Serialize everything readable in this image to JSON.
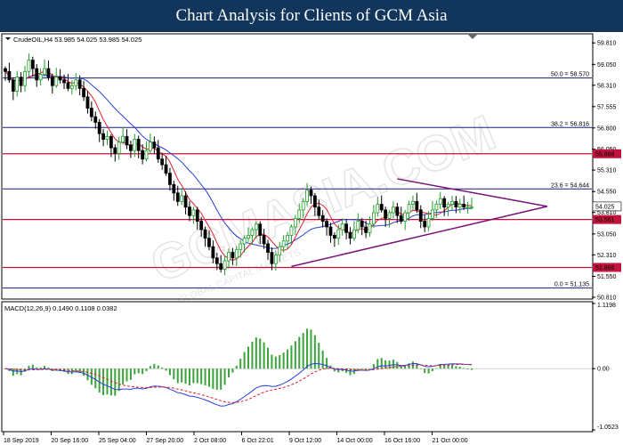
{
  "header": {
    "title": "Chart Analysis for Clients of GCM Asia"
  },
  "watermark": {
    "text": "GCMASIA.COM",
    "subtext": "GLOBAL CAPITAL MARKETS"
  },
  "chart_data": [
    {
      "type": "candlestick",
      "title": "CrudeOIL,H4  53.985 54.025 53.985 54.025",
      "ylim": [
        50.81,
        60.1
      ],
      "y_ticks": [
        "59.810",
        "59.050",
        "58.310",
        "57.555",
        "56.800",
        "56.050",
        "55.310",
        "54.550",
        "53.810",
        "53.050",
        "52.310",
        "51.550",
        "50.810"
      ],
      "x_ticks": [
        "18 Sep 2019",
        "20 Sep 16:00",
        "25 Sep 04:00",
        "27 Sep 20:00",
        "2 Oct 08:00",
        "6 Oct 22:01",
        "9 Oct 12:00",
        "14 Oct 00:00",
        "16 Oct 16:00",
        "21 Oct 00:00"
      ],
      "levels": [
        {
          "label": "50.0 = 58.570",
          "value": 58.57,
          "color": "#1c1c7a"
        },
        {
          "label": "38.2 = 56.816",
          "value": 56.816,
          "color": "#1c1c7a"
        },
        {
          "label": "23.6 = 54.644",
          "value": 54.644,
          "color": "#1c1c7a"
        },
        {
          "label": "0.0 = 51.135",
          "value": 51.135,
          "color": "#1c1c7a"
        }
      ],
      "sr_levels": [
        {
          "label": "55.888",
          "value": 55.888,
          "color": "#c0143c"
        },
        {
          "label": "53.561",
          "value": 53.561,
          "color": "#c0143c"
        },
        {
          "label": "51.866",
          "value": 51.866,
          "color": "#c0143c"
        }
      ],
      "current_price": {
        "label": "54.025",
        "value": 54.025
      },
      "triangle": {
        "upper": [
          [
            100,
            55.0
          ],
          [
            240,
            54.025
          ]
        ],
        "lower": [
          [
            73,
            51.9
          ],
          [
            240,
            54.025
          ]
        ],
        "color": "#7b117b"
      },
      "series_anchor_close": [
        58.8,
        58.5,
        58.1,
        58.6,
        58.3,
        58.8,
        59.2,
        58.9,
        58.5,
        58.7,
        58.9,
        58.6,
        58.3,
        58.6,
        58.5,
        58.4,
        58.2,
        58.3,
        58.5,
        58.2,
        57.9,
        57.5,
        57.2,
        57.0,
        56.6,
        56.4,
        56.5,
        56.1,
        55.9,
        56.3,
        56.5,
        56.2,
        56.0,
        56.4,
        56.0,
        55.7,
        56.0,
        56.3,
        56.1,
        55.7,
        55.5,
        55.2,
        54.8,
        54.5,
        54.2,
        54.4,
        54.0,
        53.7,
        53.9,
        53.5,
        53.2,
        52.9,
        52.6,
        52.2,
        52.0,
        51.8,
        52.1,
        52.4,
        52.2,
        52.5,
        52.7,
        52.9,
        53.0,
        53.2,
        53.4,
        53.0,
        52.7,
        52.4,
        52.0,
        52.3,
        52.6,
        52.8,
        53.0,
        53.3,
        53.6,
        53.9,
        54.2,
        54.6,
        54.4,
        54.0,
        53.7,
        53.5,
        53.3,
        53.0,
        52.9,
        53.2,
        53.4,
        53.1,
        52.9,
        53.2,
        53.5,
        53.3,
        53.1,
        53.4,
        53.8,
        54.1,
        53.9,
        53.6,
        53.8,
        54.0,
        53.7,
        53.5,
        53.8,
        54.1,
        54.2,
        53.9,
        53.5,
        53.3,
        53.6,
        53.9,
        54.1,
        54.3,
        54.0,
        54.1,
        54.2,
        54.0,
        54.1,
        54.0,
        54.0,
        54.0
      ]
    },
    {
      "type": "macd",
      "title": "MACD(12,26,9)  0.1490  0.1108  0.0382",
      "ylim": [
        -1.0523,
        1.1198
      ],
      "y_ticks": [
        "1.1198",
        "0.00",
        "-1.0523"
      ]
    }
  ]
}
